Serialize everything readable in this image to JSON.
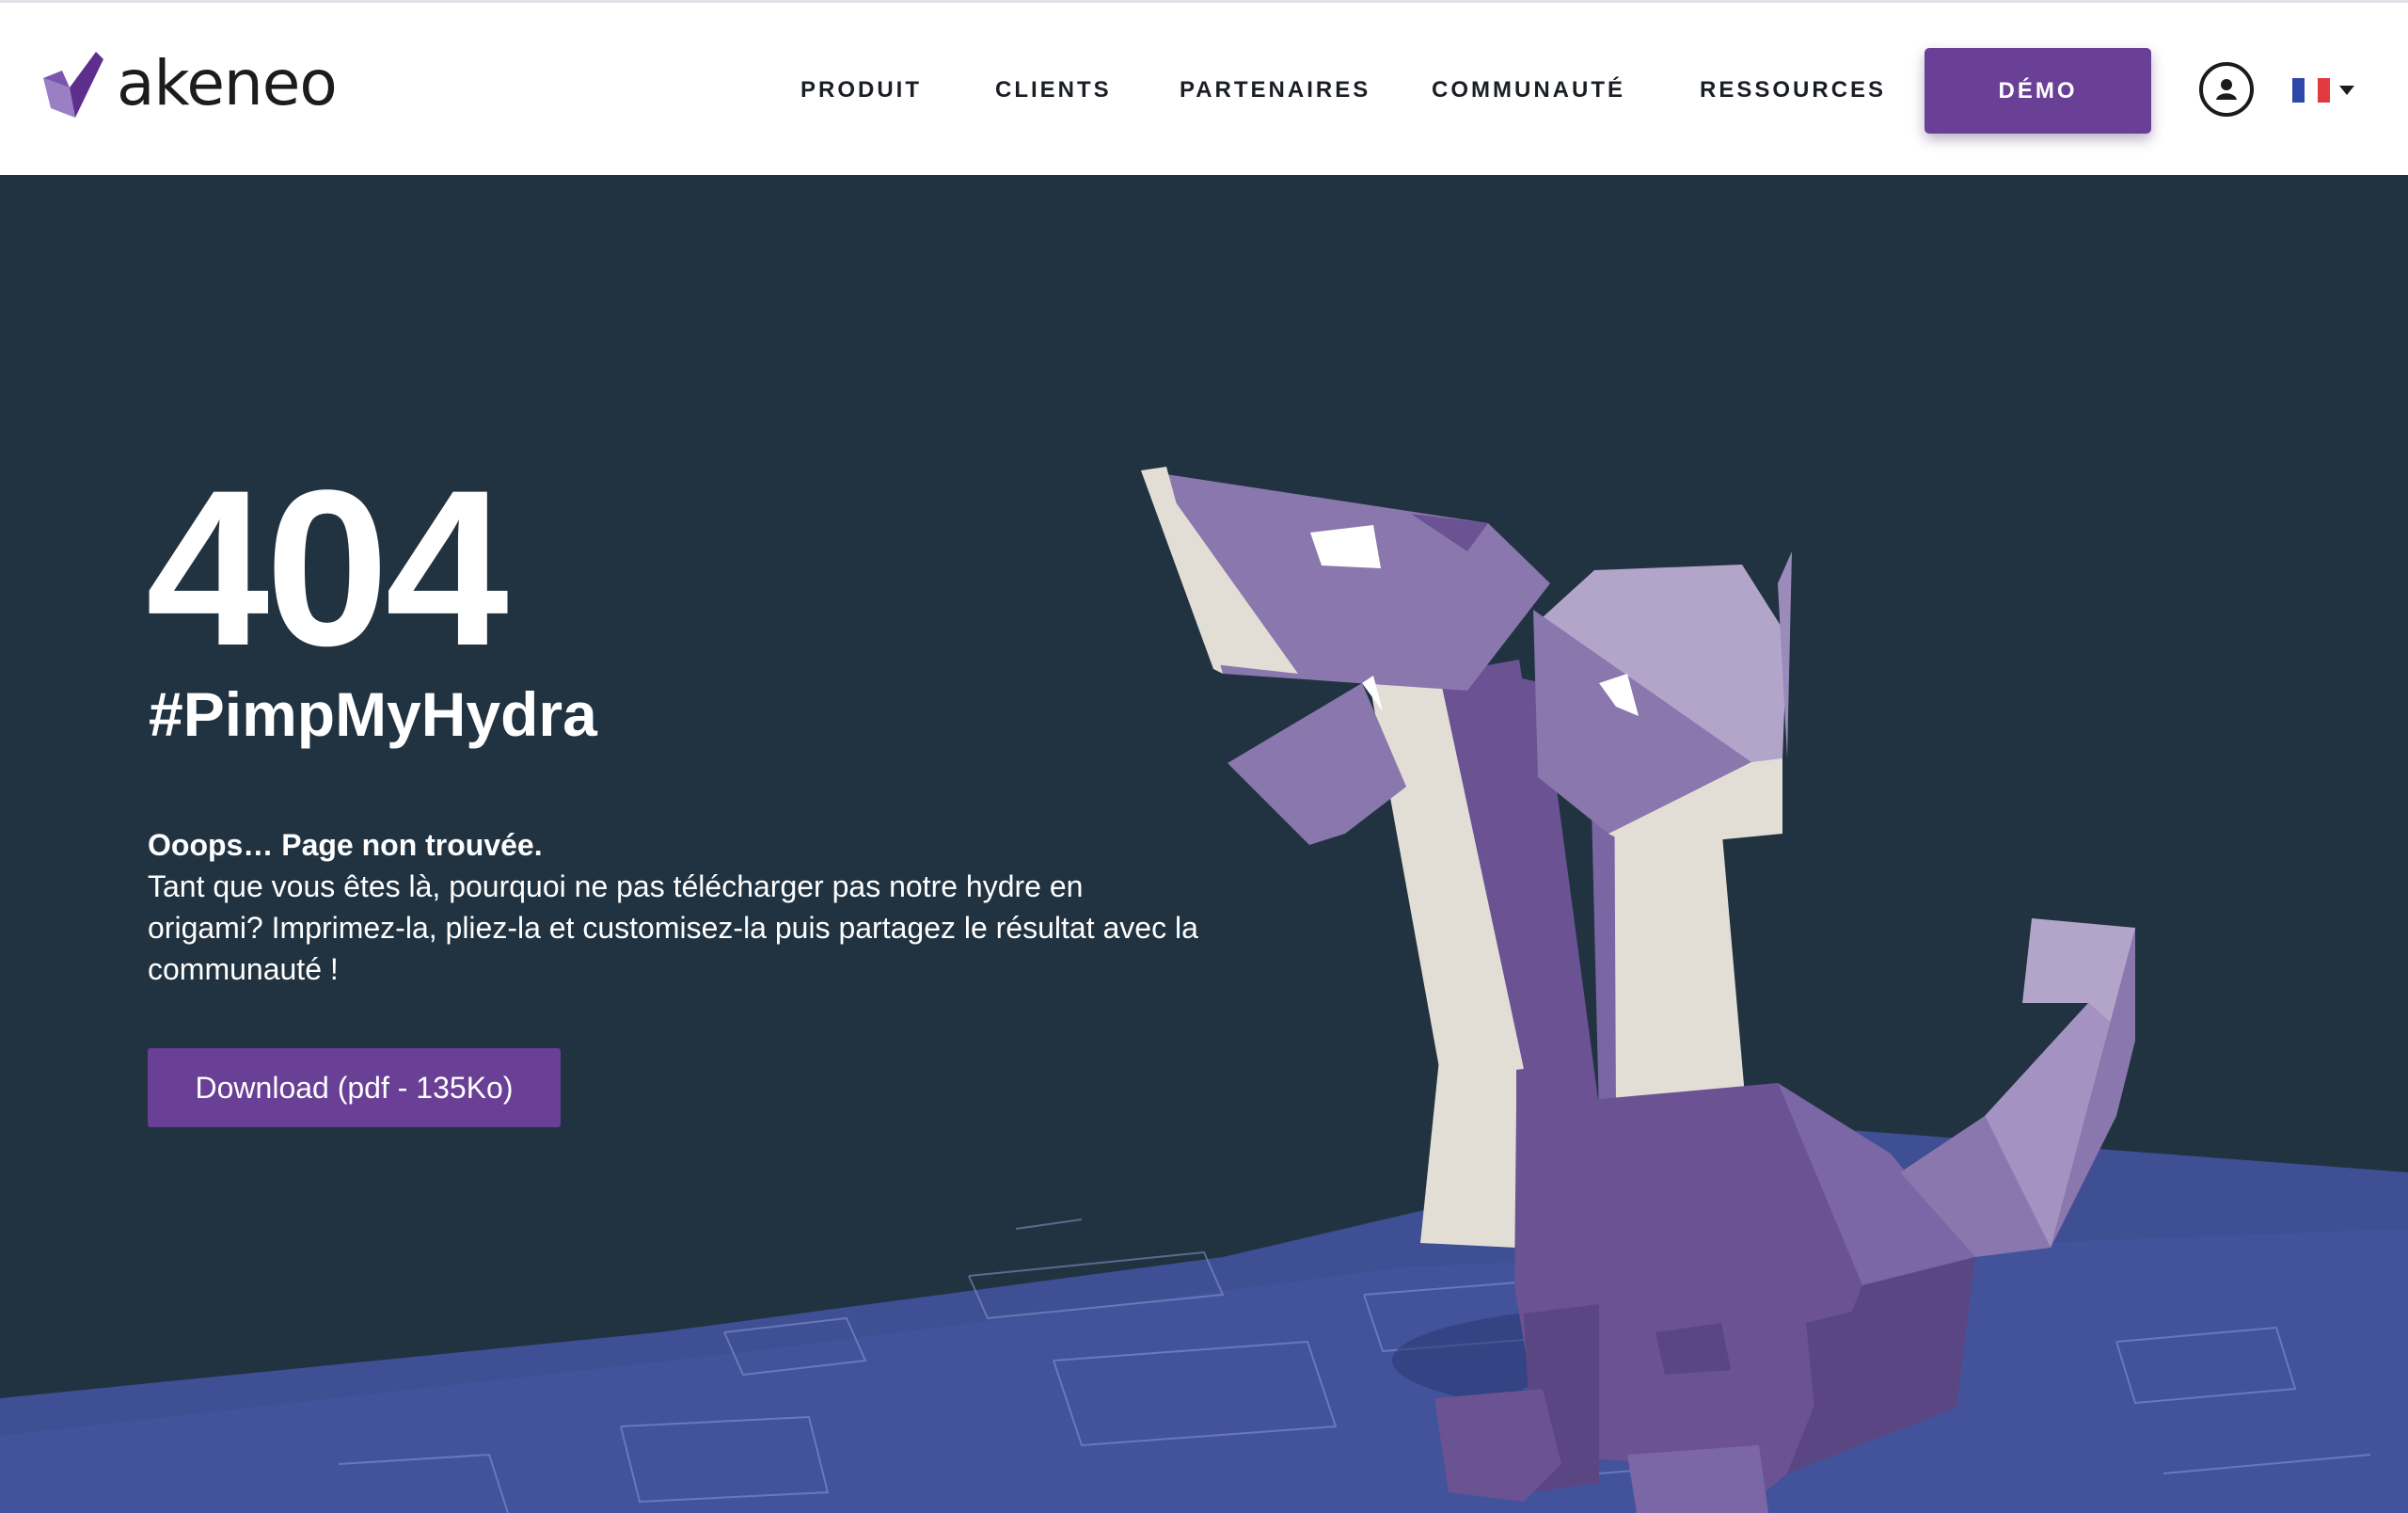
{
  "brand": {
    "name": "akeneo"
  },
  "nav": {
    "items": [
      "PRODUIT",
      "CLIENTS",
      "PARTENAIRES",
      "COMMUNAUTÉ",
      "RESSOURCES"
    ],
    "cta_label": "DÉMO",
    "language": "fr"
  },
  "hero": {
    "code": "404",
    "hashtag": "#PimpMyHydra",
    "headline": "Ooops… Page non trouvée.",
    "body": "Tant que vous êtes là, pourquoi ne pas télécharger pas notre hydre en origami? Imprimez-la, pliez-la et customisez-la puis partagez le résultat avec la communauté !",
    "download_label": "Download (pdf - 135Ko)"
  },
  "colors": {
    "accent": "#6a3f96",
    "hero_bg": "#213341",
    "blueprint": "#3e4f94",
    "hydra_dark": "#6a5293",
    "hydra_mid": "#8a77ad",
    "hydra_light": "#b2a5c9",
    "paper": "#e2ded6"
  },
  "icons": {
    "account": "user-circle-icon",
    "language": "france-flag-icon",
    "caret": "caret-down-icon"
  }
}
